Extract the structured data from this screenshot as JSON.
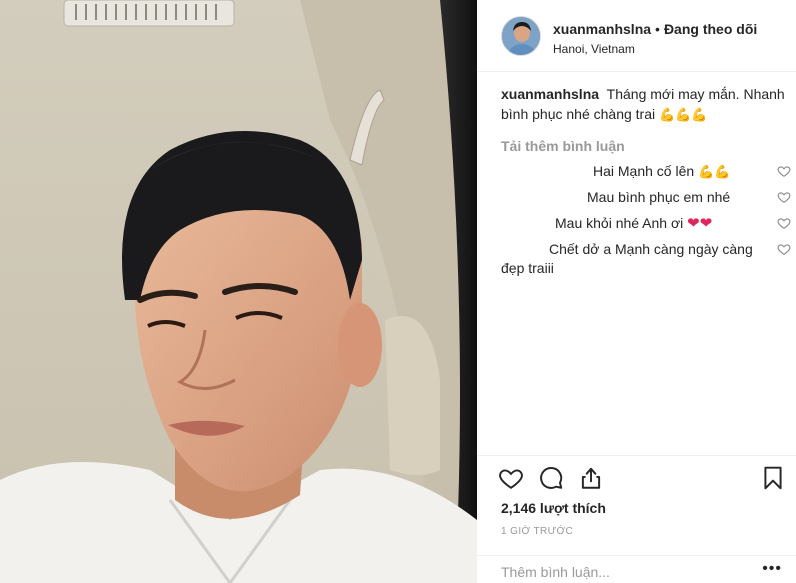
{
  "post": {
    "username": "xuanmanhslna",
    "follow_status": "Đang theo dõi",
    "separator": "•",
    "location": "Hanoi, Vietnam",
    "caption": "Tháng mới may mắn. Nhanh bình phục nhé chàng trai",
    "caption_emoji": "💪💪💪",
    "load_more": "Tải thêm bình luận",
    "likes": "2,146 lượt thích",
    "time": "1 GIỜ TRƯỚC"
  },
  "comments": [
    {
      "text": "Hai Mạnh cố lên",
      "emoji": "💪💪"
    },
    {
      "text": "Mau bình phục em nhé",
      "emoji": ""
    },
    {
      "text": "Mau khỏi nhé Anh ơi",
      "emoji": "❤❤"
    },
    {
      "text_line1": "Chết dở a Mạnh càng ngày càng",
      "text_line2": "đẹp traiii"
    }
  ],
  "add_comment": {
    "placeholder": "Thêm bình luận...",
    "more_label": "•••"
  },
  "icons": {
    "like": "heart-icon",
    "comment": "comment-icon",
    "share": "share-icon",
    "save": "bookmark-icon"
  },
  "colors": {
    "text": "#262626",
    "muted": "#999999",
    "divider": "#efefef",
    "emoji": "#f2b705",
    "heart": "#e0245e"
  }
}
